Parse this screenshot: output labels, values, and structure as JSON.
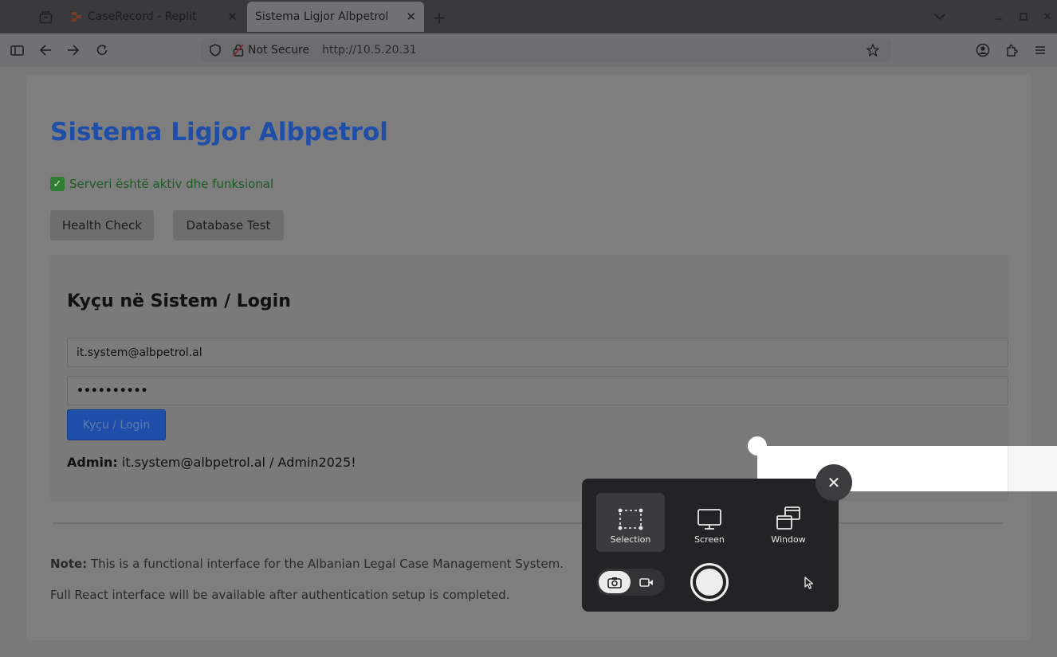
{
  "browser": {
    "tabs": [
      {
        "label": "CaseRecord - Replit",
        "active": false
      },
      {
        "label": "Sistema Ligjor Albpetrol",
        "active": true
      }
    ],
    "security_label": "Not Secure",
    "url": "http://10.5.20.31",
    "icons": [
      "tabs-overview-icon",
      "close-icon",
      "plus-icon",
      "chevron-down-icon",
      "minimize-icon",
      "maximize-icon",
      "sidebar-icon",
      "back-arrow-icon",
      "forward-arrow-icon",
      "reload-icon",
      "shield-icon",
      "lock-warning-icon",
      "star-icon",
      "account-icon",
      "extensions-icon",
      "menu-icon"
    ]
  },
  "page": {
    "title": "Sistema Ligjor Albpetrol",
    "status_text": "Serveri është aktiv dhe funksional",
    "health_button": "Health Check",
    "db_button": "Database Test",
    "login": {
      "heading": "Kyçu në Sistem / Login",
      "email_value": "it.system@albpetrol.al",
      "password_value": "••••••••••",
      "submit_label": "Kyçu / Login",
      "admin_label": "Admin:",
      "admin_credentials": " it.system@albpetrol.al / Admin2025!"
    },
    "note_label": "Note:",
    "note_text": " This is a functional interface for the Albanian Legal Case Management System.",
    "note_text_2": "Full React interface will be available after authentication setup is completed."
  },
  "screenshot_tool": {
    "modes": [
      {
        "label": "Selection",
        "icon": "selection-icon",
        "active": true
      },
      {
        "label": "Screen",
        "icon": "monitor-icon",
        "active": false
      },
      {
        "label": "Window",
        "icon": "window-icon",
        "active": false
      }
    ],
    "capture_type": "screenshot",
    "icons": [
      "camera-icon",
      "video-icon",
      "shutter-icon",
      "pointer-icon",
      "close-icon"
    ]
  },
  "colors": {
    "title_blue": "#1f4ea8",
    "status_green": "#1d5a22",
    "tool_panel": "#232325"
  }
}
